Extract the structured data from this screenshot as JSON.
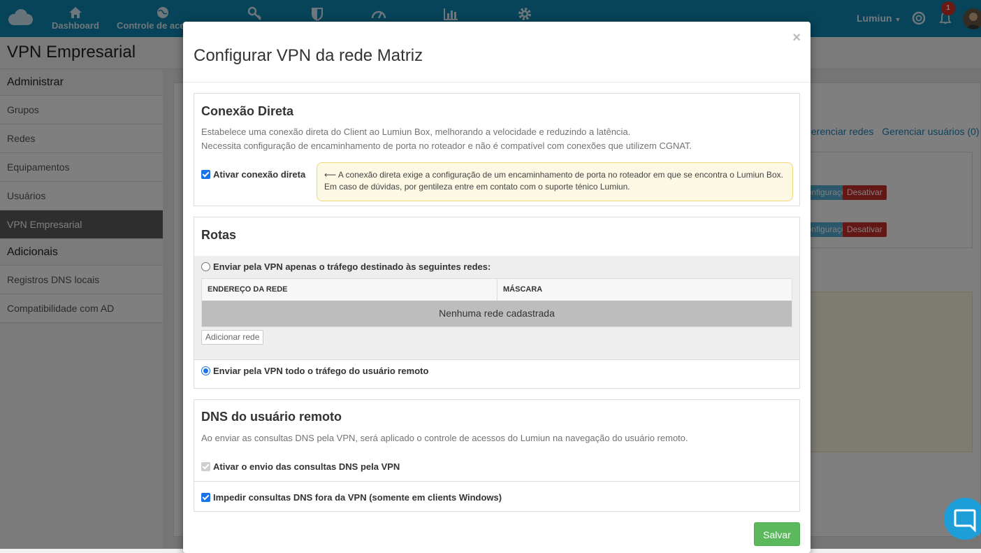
{
  "nav": {
    "items": [
      {
        "label": "Dashboard",
        "icon": "home-icon"
      },
      {
        "label": "Controle de acessos",
        "icon": "globe-icon"
      },
      {
        "label": "",
        "icon": "key-icon"
      },
      {
        "label": "",
        "icon": "shield-icon"
      },
      {
        "label": "",
        "icon": "speedometer-icon"
      },
      {
        "label": "",
        "icon": "bar-chart-icon"
      },
      {
        "label": "",
        "icon": "gear-icon"
      }
    ],
    "user_name": "Lumiun",
    "notification_count": "1"
  },
  "page": {
    "title": "VPN Empresarial",
    "links": [
      "Gerenciar redes",
      "Gerenciar usuários (0)"
    ],
    "row_buttons": [
      "Configurações",
      "Desativar"
    ]
  },
  "sidebar": {
    "sections": [
      {
        "heading": "Administrar",
        "items": [
          "Grupos",
          "Redes",
          "Equipamentos",
          "Usuários",
          "VPN Empresarial"
        ]
      },
      {
        "heading": "Adicionais",
        "items": [
          "Registros DNS locais",
          "Compatibilidade com AD"
        ]
      }
    ],
    "active": "VPN Empresarial"
  },
  "modal": {
    "title": "Configurar VPN da rede Matriz",
    "close_label": "×",
    "direct": {
      "title": "Conexão Direta",
      "desc1": "Estabelece uma conexão direta do Client ao Lumiun Box, melhorando a velocidade e reduzindo a latência.",
      "desc2": "Necessita configuração de encaminhamento de porta no roteador e não é compatível com conexões que utilizem CGNAT.",
      "checkbox_label": "Ativar conexão direta",
      "checked": true,
      "alert_arrow": "⟵",
      "alert_line1": "A conexão direta exige a configuração de um encaminhamento de porta no roteador em que se encontra o Lumiun Box.",
      "alert_line2": "Em caso de dúvidas, por gentileza entre em contato com o suporte ténico Lumiun."
    },
    "routes": {
      "title": "Rotas",
      "option_specific": "Enviar pela VPN apenas o tráfego destinado às seguintes redes:",
      "col_address": "ENDEREÇO DA REDE",
      "col_mask": "MÁSCARA",
      "empty_text": "Nenhuma rede cadastrada",
      "add_button": "Adicionar rede",
      "option_all": "Enviar pela VPN todo o tráfego do usuário remoto",
      "selected": "all"
    },
    "dns": {
      "title": "DNS do usuário remoto",
      "desc": "Ao enviar as consultas DNS pela VPN, será aplicado o controle de acessos do Lumiun na navegação do usuário remoto.",
      "send_label": "Ativar o envio das consultas DNS pela VPN",
      "block_label": "Impedir consultas DNS fora da VPN (somente em clients Windows)"
    },
    "save_button": "Salvar"
  },
  "colors": {
    "nav_bg": "#0e86b3",
    "primary_check": "#1a73e8",
    "save_green": "#5cb85c",
    "danger_red": "#c9302c",
    "warning_bg": "#fcf8e3"
  }
}
